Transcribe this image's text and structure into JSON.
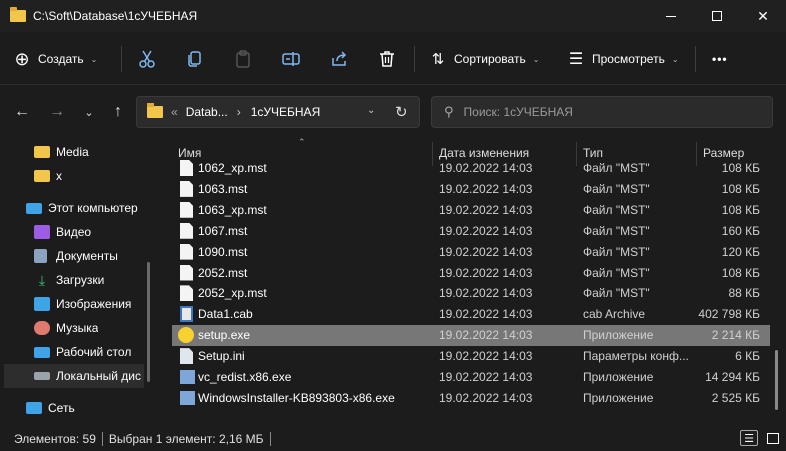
{
  "window": {
    "title": "C:\\Soft\\Database\\1cУЧЕБНАЯ",
    "minimize_glyph": "—",
    "maximize_glyph": "☐",
    "close_glyph": "✕"
  },
  "toolbar": {
    "create_label": "Создать",
    "sort_label": "Сортировать",
    "view_label": "Просмотреть",
    "more_glyph": "•••",
    "icons": [
      "plus-icon",
      "cut-icon",
      "copy-icon",
      "paste-icon",
      "rename-icon",
      "share-icon",
      "delete-icon",
      "sort-icon",
      "view-icon",
      "more-icon"
    ]
  },
  "address": {
    "sep_glyph": "«",
    "crumbs": [
      "Datab...",
      "1cУЧЕБНАЯ"
    ],
    "crumb_arrow": "›"
  },
  "search": {
    "placeholder": "Поиск: 1cУЧЕБНАЯ"
  },
  "sidebar": {
    "items": [
      {
        "label": "Media",
        "icon": "folder-icon"
      },
      {
        "label": "x",
        "icon": "folder-icon"
      },
      {
        "label": "Этот компьютер",
        "icon": "computer-icon"
      },
      {
        "label": "Видео",
        "icon": "video-icon"
      },
      {
        "label": "Документы",
        "icon": "documents-icon"
      },
      {
        "label": "Загрузки",
        "icon": "downloads-icon"
      },
      {
        "label": "Изображения",
        "icon": "pictures-icon"
      },
      {
        "label": "Музыка",
        "icon": "music-icon"
      },
      {
        "label": "Рабочий стол",
        "icon": "desktop-icon"
      },
      {
        "label": "Локальный дис",
        "icon": "drive-icon",
        "selected": true
      },
      {
        "label": "Сеть",
        "icon": "network-icon"
      }
    ]
  },
  "columns": {
    "name": "Имя",
    "date": "Дата изменения",
    "type": "Тип",
    "size": "Размер"
  },
  "files": [
    {
      "name": "1062_xp.mst",
      "date": "19.02.2022 14:03",
      "type": "Файл \"MST\"",
      "size": "108 КБ",
      "icon": "file-icon"
    },
    {
      "name": "1063.mst",
      "date": "19.02.2022 14:03",
      "type": "Файл \"MST\"",
      "size": "108 КБ",
      "icon": "file-icon"
    },
    {
      "name": "1063_xp.mst",
      "date": "19.02.2022 14:03",
      "type": "Файл \"MST\"",
      "size": "108 КБ",
      "icon": "file-icon"
    },
    {
      "name": "1067.mst",
      "date": "19.02.2022 14:03",
      "type": "Файл \"MST\"",
      "size": "160 КБ",
      "icon": "file-icon"
    },
    {
      "name": "1090.mst",
      "date": "19.02.2022 14:03",
      "type": "Файл \"MST\"",
      "size": "120 КБ",
      "icon": "file-icon"
    },
    {
      "name": "2052.mst",
      "date": "19.02.2022 14:03",
      "type": "Файл \"MST\"",
      "size": "108 КБ",
      "icon": "file-icon"
    },
    {
      "name": "2052_xp.mst",
      "date": "19.02.2022 14:03",
      "type": "Файл \"MST\"",
      "size": "88 КБ",
      "icon": "file-icon"
    },
    {
      "name": "Data1.cab",
      "date": "19.02.2022 14:03",
      "type": "cab Archive",
      "size": "402 798 КБ",
      "icon": "cab-icon"
    },
    {
      "name": "setup.exe",
      "date": "19.02.2022 14:03",
      "type": "Приложение",
      "size": "2 214 КБ",
      "icon": "1c-app-icon",
      "selected": true
    },
    {
      "name": "Setup.ini",
      "date": "19.02.2022 14:03",
      "type": "Параметры конф...",
      "size": "6 КБ",
      "icon": "ini-icon"
    },
    {
      "name": "vc_redist.x86.exe",
      "date": "19.02.2022 14:03",
      "type": "Приложение",
      "size": "14 294 КБ",
      "icon": "installer-icon"
    },
    {
      "name": "WindowsInstaller-KB893803-x86.exe",
      "date": "19.02.2022 14:03",
      "type": "Приложение",
      "size": "2 525 КБ",
      "icon": "installer-icon"
    }
  ],
  "status": {
    "items_count": "Элементов: 59",
    "selected_info": "Выбран 1 элемент: 2,16 МБ"
  },
  "colors": {
    "background": "#1c1c1c",
    "titlebar": "#202020",
    "selected_row": "#777777",
    "folder": "#f2c54b",
    "accent_icon": "#7fb8f0"
  }
}
